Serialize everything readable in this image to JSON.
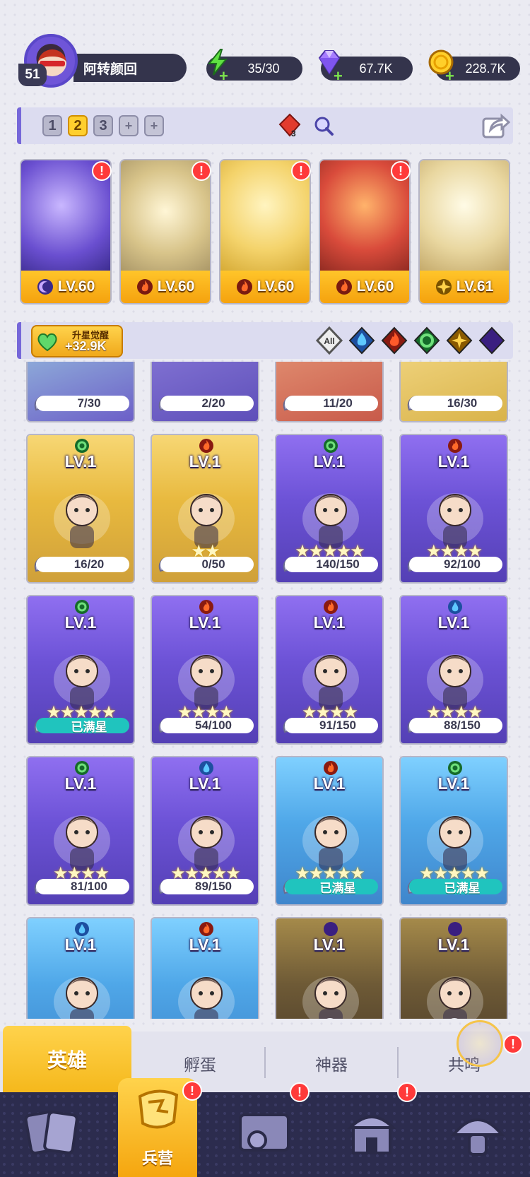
{
  "player": {
    "level": "51",
    "name": "阿转颜回"
  },
  "resources": {
    "energy": "35/30",
    "gems": "67.7K",
    "coins": "228.7K"
  },
  "team_bar": {
    "slots": [
      "1",
      "2",
      "3",
      "+",
      "+"
    ],
    "active_slot": "2",
    "gem_count": "3"
  },
  "team": [
    {
      "level": "LV.60",
      "element": "dark",
      "color": "#6a4fd0"
    },
    {
      "level": "LV.60",
      "element": "fire",
      "color": "#c9b07a"
    },
    {
      "level": "LV.60",
      "element": "fire",
      "color": "#f4d36b"
    },
    {
      "level": "LV.60",
      "element": "fire",
      "color": "#d94b3b"
    },
    {
      "level": "LV.61",
      "element": "light",
      "color": "#e9d7a0"
    }
  ],
  "filter": {
    "awaken_title": "升星觉醒",
    "awaken_value": "+32.9K",
    "all_label": "All",
    "elements": [
      "water",
      "fire",
      "wind",
      "light",
      "dark"
    ]
  },
  "heroes_partial": [
    {
      "progress": "7/30",
      "bg": "#6c5fc8"
    },
    {
      "progress": "2/20",
      "bg": "#5e4fb9"
    },
    {
      "progress": "11/20",
      "bg": "#c85a4a"
    },
    {
      "progress": "16/30",
      "bg": "#d9b34a"
    }
  ],
  "heroes": [
    {
      "level": "LV.1",
      "element": "wind",
      "stars": "",
      "progress": "16/20",
      "full": false,
      "bg": "gold"
    },
    {
      "level": "LV.1",
      "element": "fire",
      "stars": "★★",
      "progress": "0/50",
      "full": false,
      "bg": "gold"
    },
    {
      "level": "LV.1",
      "element": "wind",
      "stars": "★★★★★",
      "progress": "140/150",
      "full": false,
      "bg": "purple"
    },
    {
      "level": "LV.1",
      "element": "fire",
      "stars": "★★★★",
      "progress": "92/100",
      "full": false,
      "bg": "purple"
    },
    {
      "level": "LV.1",
      "element": "wind",
      "stars": "★★★★★",
      "progress": "已满星",
      "full": true,
      "bg": "purple"
    },
    {
      "level": "LV.1",
      "element": "fire",
      "stars": "★★★★",
      "progress": "54/100",
      "full": false,
      "bg": "purple"
    },
    {
      "level": "LV.1",
      "element": "fire",
      "stars": "★★★★",
      "progress": "91/150",
      "full": false,
      "bg": "purple"
    },
    {
      "level": "LV.1",
      "element": "water",
      "stars": "★★★★",
      "progress": "88/150",
      "full": false,
      "bg": "purple"
    },
    {
      "level": "LV.1",
      "element": "wind",
      "stars": "★★★★",
      "progress": "81/100",
      "full": false,
      "bg": "purple"
    },
    {
      "level": "LV.1",
      "element": "water",
      "stars": "★★★★★",
      "progress": "89/150",
      "full": false,
      "bg": "purple"
    },
    {
      "level": "LV.1",
      "element": "fire",
      "stars": "★★★★★",
      "progress": "已满星",
      "full": true,
      "bg": "blue"
    },
    {
      "level": "LV.1",
      "element": "wind",
      "stars": "★★★★★",
      "progress": "已满星",
      "full": true,
      "bg": "blue"
    },
    {
      "level": "LV.1",
      "element": "water",
      "stars": "",
      "progress": "",
      "full": false,
      "bg": "blue"
    },
    {
      "level": "LV.1",
      "element": "fire",
      "stars": "",
      "progress": "",
      "full": false,
      "bg": "blue"
    },
    {
      "level": "LV.1",
      "element": "dark",
      "stars": "",
      "progress": "",
      "full": false,
      "bg": "locked",
      "locked": true
    },
    {
      "level": "LV.1",
      "element": "dark",
      "stars": "",
      "progress": "",
      "full": false,
      "bg": "locked",
      "locked": true
    }
  ],
  "subtabs": {
    "heroes": "英雄",
    "hatch": "孵蛋",
    "artifacts": "神器",
    "resonance": "共鸣"
  },
  "nav": {
    "barracks": "兵营"
  },
  "alerts": {
    "mark": "!"
  }
}
